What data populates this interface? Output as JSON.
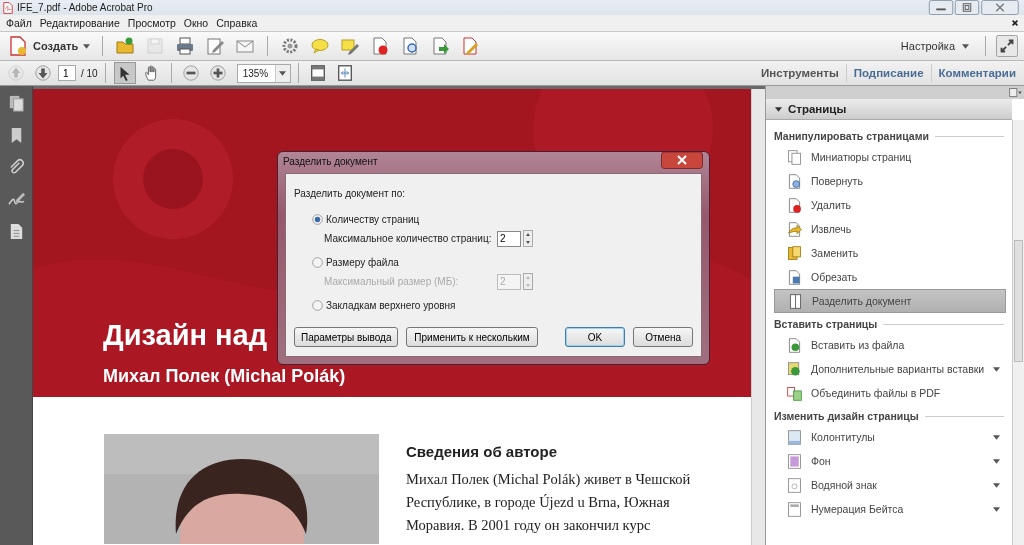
{
  "window": {
    "title": "IFE_7.pdf - Adobe Acrobat Pro"
  },
  "menu": [
    "Файл",
    "Редактирование",
    "Просмотр",
    "Окно",
    "Справка"
  ],
  "toolbar": {
    "create": "Создать",
    "customize": "Настройка",
    "tool_groups": [
      [
        {
          "kind": "open",
          "disabled": false
        },
        {
          "kind": "save",
          "disabled": true
        },
        {
          "kind": "print",
          "disabled": false
        },
        {
          "kind": "edit",
          "disabled": false
        },
        {
          "kind": "email",
          "disabled": false
        }
      ],
      [
        {
          "kind": "gear",
          "disabled": false
        },
        {
          "kind": "comment",
          "disabled": false
        },
        {
          "kind": "textedit",
          "disabled": false
        },
        {
          "kind": "pagedelete",
          "disabled": false
        },
        {
          "kind": "pagesearch",
          "disabled": false
        },
        {
          "kind": "pageexport",
          "disabled": false
        },
        {
          "kind": "pageedit",
          "disabled": false
        }
      ]
    ]
  },
  "nav": {
    "buttons": [
      {
        "kind": "prev",
        "disabled": true
      },
      {
        "kind": "next",
        "disabled": false
      }
    ],
    "page": "1",
    "page_count": "/ 10",
    "tools": [
      {
        "kind": "select",
        "selected": true
      },
      {
        "kind": "hand",
        "selected": false
      }
    ],
    "zoom_buttons": [
      {
        "kind": "zoomout"
      },
      {
        "kind": "zoomin"
      }
    ],
    "zoom": "135%",
    "view_buttons": [
      {
        "kind": "fullscreen"
      },
      {
        "kind": "fitpage"
      }
    ]
  },
  "panes": [
    {
      "label": "Инструменты",
      "selected": true
    },
    {
      "label": "Подписание",
      "selected": false
    },
    {
      "label": "Комментарии",
      "selected": false
    }
  ],
  "document": {
    "title": "Дизайн над",
    "subtitle": "Михал Полек (Michal Polák)",
    "heading": "Сведения об авторе",
    "body": "Михал Полек (Michal Polák) живет в Чешской Республике, в городе Újezd u Brna, Южная Моравия. В 2001 году он закончил курс"
  },
  "dialog": {
    "title": "Разделить документ",
    "prompt": "Разделить документ по:",
    "options": [
      {
        "label": "Количеству страниц",
        "selected": true,
        "field": {
          "label": "Максимальное количество страниц:",
          "value": "2",
          "disabled": false
        }
      },
      {
        "label": "Размеру файла",
        "selected": false,
        "field": {
          "label": "Максимальный размер (МБ):",
          "value": "2",
          "disabled": true
        }
      },
      {
        "label": "Закладкам верхнего уровня",
        "selected": false
      }
    ],
    "buttons": [
      {
        "label": "Параметры вывода",
        "default": false
      },
      {
        "label": "Применить к нескольким",
        "default": false
      },
      {
        "label": "OK",
        "default": true
      },
      {
        "label": "Отмена",
        "default": false
      }
    ]
  },
  "panel": {
    "title": "Страницы",
    "expanded": true,
    "groups": [
      {
        "title": "Манипулировать страницами",
        "items": [
          {
            "label": "Миниатюры страниц",
            "selected": false,
            "has_menu": false
          },
          {
            "label": "Повернуть",
            "selected": false,
            "has_menu": false
          },
          {
            "label": "Удалить",
            "selected": false,
            "has_menu": false
          },
          {
            "label": "Извлечь",
            "selected": false,
            "has_menu": false
          },
          {
            "label": "Заменить",
            "selected": false,
            "has_menu": false
          },
          {
            "label": "Обрезать",
            "selected": false,
            "has_menu": false
          },
          {
            "label": "Разделить документ",
            "selected": true,
            "has_menu": false
          }
        ]
      },
      {
        "title": "Вставить страницы",
        "items": [
          {
            "label": "Вставить из файла",
            "selected": false,
            "has_menu": false
          },
          {
            "label": "Дополнительные варианты вставки",
            "selected": false,
            "has_menu": true
          },
          {
            "label": "Объединить файлы в PDF",
            "selected": false,
            "has_menu": false
          }
        ]
      },
      {
        "title": "Изменить дизайн страницы",
        "items": [
          {
            "label": "Колонтитулы",
            "selected": false,
            "has_menu": true
          },
          {
            "label": "Фон",
            "selected": false,
            "has_menu": true
          },
          {
            "label": "Водяной знак",
            "selected": false,
            "has_menu": true
          },
          {
            "label": "Нумерация Бейтса",
            "selected": false,
            "has_menu": true
          }
        ]
      }
    ]
  }
}
